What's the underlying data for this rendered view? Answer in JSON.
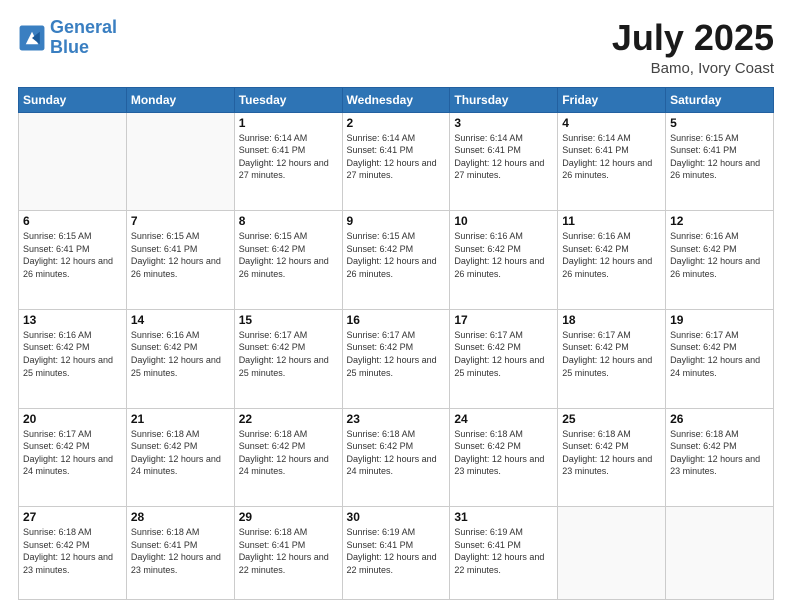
{
  "header": {
    "logo_line1": "General",
    "logo_line2": "Blue",
    "title": "July 2025",
    "subtitle": "Bamo, Ivory Coast"
  },
  "weekdays": [
    "Sunday",
    "Monday",
    "Tuesday",
    "Wednesday",
    "Thursday",
    "Friday",
    "Saturday"
  ],
  "weeks": [
    [
      {
        "day": "",
        "info": ""
      },
      {
        "day": "",
        "info": ""
      },
      {
        "day": "1",
        "info": "Sunrise: 6:14 AM\nSunset: 6:41 PM\nDaylight: 12 hours and 27 minutes."
      },
      {
        "day": "2",
        "info": "Sunrise: 6:14 AM\nSunset: 6:41 PM\nDaylight: 12 hours and 27 minutes."
      },
      {
        "day": "3",
        "info": "Sunrise: 6:14 AM\nSunset: 6:41 PM\nDaylight: 12 hours and 27 minutes."
      },
      {
        "day": "4",
        "info": "Sunrise: 6:14 AM\nSunset: 6:41 PM\nDaylight: 12 hours and 26 minutes."
      },
      {
        "day": "5",
        "info": "Sunrise: 6:15 AM\nSunset: 6:41 PM\nDaylight: 12 hours and 26 minutes."
      }
    ],
    [
      {
        "day": "6",
        "info": "Sunrise: 6:15 AM\nSunset: 6:41 PM\nDaylight: 12 hours and 26 minutes."
      },
      {
        "day": "7",
        "info": "Sunrise: 6:15 AM\nSunset: 6:41 PM\nDaylight: 12 hours and 26 minutes."
      },
      {
        "day": "8",
        "info": "Sunrise: 6:15 AM\nSunset: 6:42 PM\nDaylight: 12 hours and 26 minutes."
      },
      {
        "day": "9",
        "info": "Sunrise: 6:15 AM\nSunset: 6:42 PM\nDaylight: 12 hours and 26 minutes."
      },
      {
        "day": "10",
        "info": "Sunrise: 6:16 AM\nSunset: 6:42 PM\nDaylight: 12 hours and 26 minutes."
      },
      {
        "day": "11",
        "info": "Sunrise: 6:16 AM\nSunset: 6:42 PM\nDaylight: 12 hours and 26 minutes."
      },
      {
        "day": "12",
        "info": "Sunrise: 6:16 AM\nSunset: 6:42 PM\nDaylight: 12 hours and 26 minutes."
      }
    ],
    [
      {
        "day": "13",
        "info": "Sunrise: 6:16 AM\nSunset: 6:42 PM\nDaylight: 12 hours and 25 minutes."
      },
      {
        "day": "14",
        "info": "Sunrise: 6:16 AM\nSunset: 6:42 PM\nDaylight: 12 hours and 25 minutes."
      },
      {
        "day": "15",
        "info": "Sunrise: 6:17 AM\nSunset: 6:42 PM\nDaylight: 12 hours and 25 minutes."
      },
      {
        "day": "16",
        "info": "Sunrise: 6:17 AM\nSunset: 6:42 PM\nDaylight: 12 hours and 25 minutes."
      },
      {
        "day": "17",
        "info": "Sunrise: 6:17 AM\nSunset: 6:42 PM\nDaylight: 12 hours and 25 minutes."
      },
      {
        "day": "18",
        "info": "Sunrise: 6:17 AM\nSunset: 6:42 PM\nDaylight: 12 hours and 25 minutes."
      },
      {
        "day": "19",
        "info": "Sunrise: 6:17 AM\nSunset: 6:42 PM\nDaylight: 12 hours and 24 minutes."
      }
    ],
    [
      {
        "day": "20",
        "info": "Sunrise: 6:17 AM\nSunset: 6:42 PM\nDaylight: 12 hours and 24 minutes."
      },
      {
        "day": "21",
        "info": "Sunrise: 6:18 AM\nSunset: 6:42 PM\nDaylight: 12 hours and 24 minutes."
      },
      {
        "day": "22",
        "info": "Sunrise: 6:18 AM\nSunset: 6:42 PM\nDaylight: 12 hours and 24 minutes."
      },
      {
        "day": "23",
        "info": "Sunrise: 6:18 AM\nSunset: 6:42 PM\nDaylight: 12 hours and 24 minutes."
      },
      {
        "day": "24",
        "info": "Sunrise: 6:18 AM\nSunset: 6:42 PM\nDaylight: 12 hours and 23 minutes."
      },
      {
        "day": "25",
        "info": "Sunrise: 6:18 AM\nSunset: 6:42 PM\nDaylight: 12 hours and 23 minutes."
      },
      {
        "day": "26",
        "info": "Sunrise: 6:18 AM\nSunset: 6:42 PM\nDaylight: 12 hours and 23 minutes."
      }
    ],
    [
      {
        "day": "27",
        "info": "Sunrise: 6:18 AM\nSunset: 6:42 PM\nDaylight: 12 hours and 23 minutes."
      },
      {
        "day": "28",
        "info": "Sunrise: 6:18 AM\nSunset: 6:41 PM\nDaylight: 12 hours and 23 minutes."
      },
      {
        "day": "29",
        "info": "Sunrise: 6:18 AM\nSunset: 6:41 PM\nDaylight: 12 hours and 22 minutes."
      },
      {
        "day": "30",
        "info": "Sunrise: 6:19 AM\nSunset: 6:41 PM\nDaylight: 12 hours and 22 minutes."
      },
      {
        "day": "31",
        "info": "Sunrise: 6:19 AM\nSunset: 6:41 PM\nDaylight: 12 hours and 22 minutes."
      },
      {
        "day": "",
        "info": ""
      },
      {
        "day": "",
        "info": ""
      }
    ]
  ]
}
